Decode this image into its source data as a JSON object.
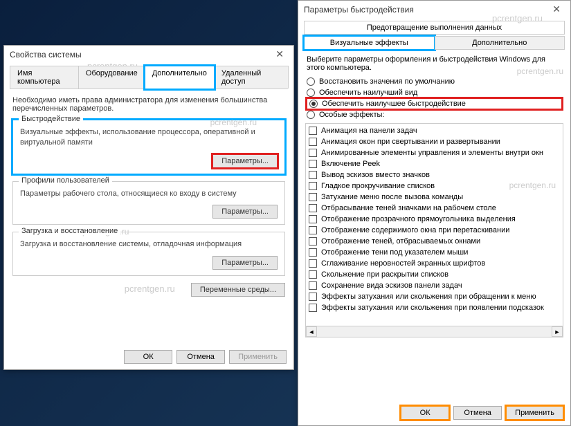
{
  "left": {
    "title": "Свойства системы",
    "watermark": "pcrentgen.ru",
    "tabs": [
      "Имя компьютера",
      "Оборудование",
      "Дополнительно",
      "Удаленный доступ"
    ],
    "active_tab": 2,
    "intro": "Необходимо иметь права администратора для изменения большинства перечисленных параметров.",
    "groups": [
      {
        "title": "Быстродействие",
        "text": "Визуальные эффекты, использование процессора, оперативной и виртуальной памяти",
        "button": "Параметры...",
        "highlight": "blue-red"
      },
      {
        "title": "Профили пользователей",
        "text": "Параметры рабочего стола, относящиеся ко входу в систему",
        "button": "Параметры..."
      },
      {
        "title": "Загрузка и восстановление",
        "text": "Загрузка и восстановление системы, отладочная информация",
        "button": "Параметры..."
      }
    ],
    "env_button": "Переменные среды...",
    "buttons": {
      "ok": "ОК",
      "cancel": "Отмена",
      "apply": "Применить"
    }
  },
  "right": {
    "title": "Параметры быстродействия",
    "top_tab": "Предотвращение выполнения данных",
    "tabs": [
      "Визуальные эффекты",
      "Дополнительно"
    ],
    "active_tab": 0,
    "desc": "Выберите параметры оформления и быстродействия Windows для этого компьютера.",
    "radios": [
      "Восстановить значения по умолчанию",
      "Обеспечить наилучший вид",
      "Обеспечить наилучшее быстродействие",
      "Особые эффекты:"
    ],
    "selected_radio": 2,
    "checks": [
      "Анимация на панели задач",
      "Анимация окон при свертывании и развертывании",
      "Анимированные элементы управления и элементы внутри окн",
      "Включение Peek",
      "Вывод эскизов вместо значков",
      "Гладкое прокручивание списков",
      "Затухание меню после вызова команды",
      "Отбрасывание теней значками на рабочем столе",
      "Отображение прозрачного прямоугольника выделения",
      "Отображение содержимого окна при перетаскивании",
      "Отображение теней, отбрасываемых окнами",
      "Отображение тени под указателем мыши",
      "Сглаживание неровностей экранных шрифтов",
      "Скольжение при раскрытии списков",
      "Сохранение вида эскизов панели задач",
      "Эффекты затухания или скольжения при обращении к меню",
      "Эффекты затухания или скольжения при появлении подсказок"
    ],
    "buttons": {
      "ok": "ОК",
      "cancel": "Отмена",
      "apply": "Применить"
    },
    "watermark": "pcrentgen.ru"
  }
}
